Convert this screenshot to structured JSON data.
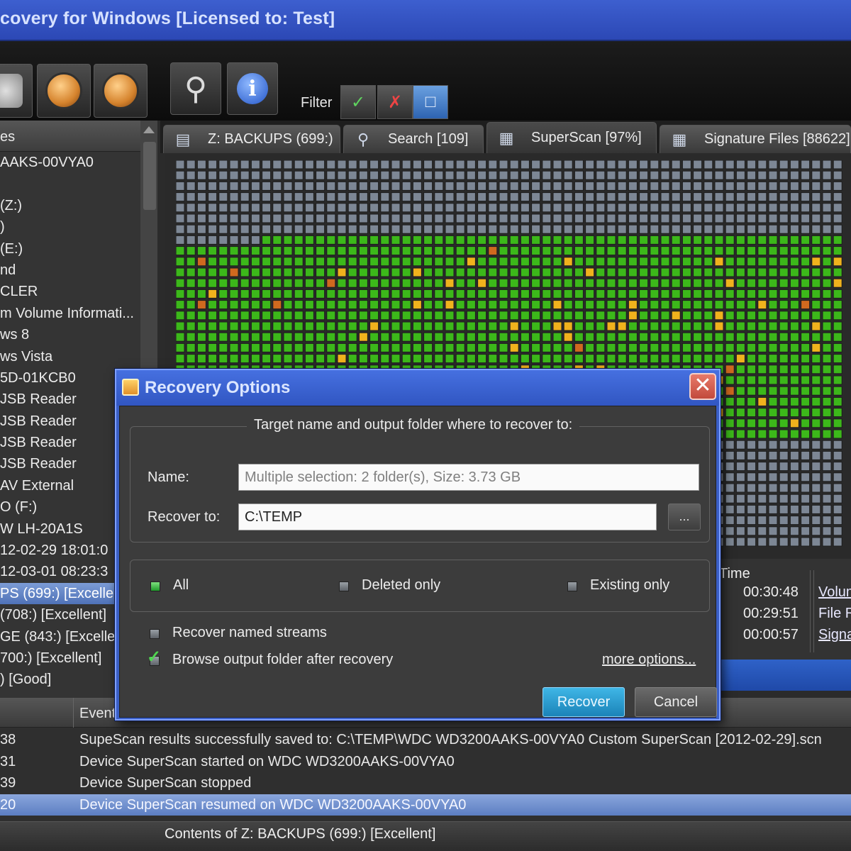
{
  "window": {
    "title": "covery for Windows [Licensed to: Test]"
  },
  "toolbar": {
    "filter_label": "Filter",
    "buttons": [
      "drive-tool-icon",
      "scan-disk-icon",
      "disks-icon",
      "preview-icon",
      "info-icon"
    ],
    "filter_buttons": [
      "filter-existing-icon",
      "filter-deleted-icon",
      "filter-all-icon"
    ]
  },
  "sidebar": {
    "header": "es",
    "items": [
      {
        "label": "AAKS-00VYA0"
      },
      {
        "label": ""
      },
      {
        "label": "(Z:)"
      },
      {
        "label": ")"
      },
      {
        "label": "(E:)"
      },
      {
        "label": "nd"
      },
      {
        "label": "CLER"
      },
      {
        "label": "m Volume Informati..."
      },
      {
        "label": "ws 8"
      },
      {
        "label": "ws Vista"
      },
      {
        "label": "5D-01KCB0"
      },
      {
        "label": "JSB Reader"
      },
      {
        "label": "JSB Reader"
      },
      {
        "label": "JSB Reader"
      },
      {
        "label": "JSB Reader"
      },
      {
        "label": "AV External"
      },
      {
        "label": "O (F:)"
      },
      {
        "label": "W LH-20A1S"
      },
      {
        "label": "12-02-29 18:01:0"
      },
      {
        "label": "12-03-01 08:23:3"
      },
      {
        "label": "PS (699:) [Excellen"
      },
      {
        "label": "(708:) [Excellent]"
      },
      {
        "label": "GE (843:) [Exceller"
      },
      {
        "label": "700:) [Excellent]"
      },
      {
        "label": ") [Good]"
      }
    ],
    "selected_index": 20
  },
  "tabs": [
    {
      "label": "Z: BACKUPS (699:)",
      "icon": "drive-icon"
    },
    {
      "label": "Search [109]",
      "icon": "search-icon"
    },
    {
      "label": "SuperScan [97%]",
      "icon": "superscan-icon"
    },
    {
      "label": "Signature Files [88622]",
      "icon": "signature-icon"
    }
  ],
  "active_tab": 2,
  "colors": {
    "block_empty": "#7d8795",
    "block_used": "#3cb81a",
    "block_file": "#f0b21d",
    "block_bad": "#d0691f"
  },
  "results_panel": {
    "header": "Time",
    "times": [
      "00:30:48",
      "00:29:51",
      "00:00:57"
    ],
    "links": [
      "Volum",
      "File R",
      "Signa"
    ]
  },
  "log": {
    "header_event": "Event",
    "rows": [
      {
        "time": "38",
        "event": "SupeScan results successfully saved to: C:\\TEMP\\WDC WD3200AAKS-00VYA0 Custom SuperScan [2012-02-29].scn"
      },
      {
        "time": "31",
        "event": "Device SuperScan started on WDC WD3200AAKS-00VYA0"
      },
      {
        "time": "39",
        "event": "Device SuperScan stopped"
      },
      {
        "time": "20",
        "event": "Device SuperScan resumed on WDC WD3200AAKS-00VYA0"
      }
    ],
    "selected_index": 3
  },
  "status": {
    "text": "Contents of Z: BACKUPS (699:) [Excellent]"
  },
  "dialog": {
    "title": "Recovery Options",
    "group_label": "Target name and output folder where to recover to:",
    "name_label": "Name:",
    "name_value": "Multiple selection: 2 folder(s), Size: 3.73 GB",
    "recover_to_label": "Recover to:",
    "recover_to_value": "C:\\TEMP",
    "browse_label": "...",
    "options": {
      "all": "All",
      "deleted_only": "Deleted only",
      "existing_only": "Existing only",
      "selected": "all"
    },
    "recover_named_streams": {
      "label": "Recover named streams",
      "checked": false
    },
    "browse_output": {
      "label": "Browse output folder after recovery",
      "checked": true
    },
    "more_options": "more options...",
    "recover_button": "Recover",
    "cancel_button": "Cancel"
  }
}
